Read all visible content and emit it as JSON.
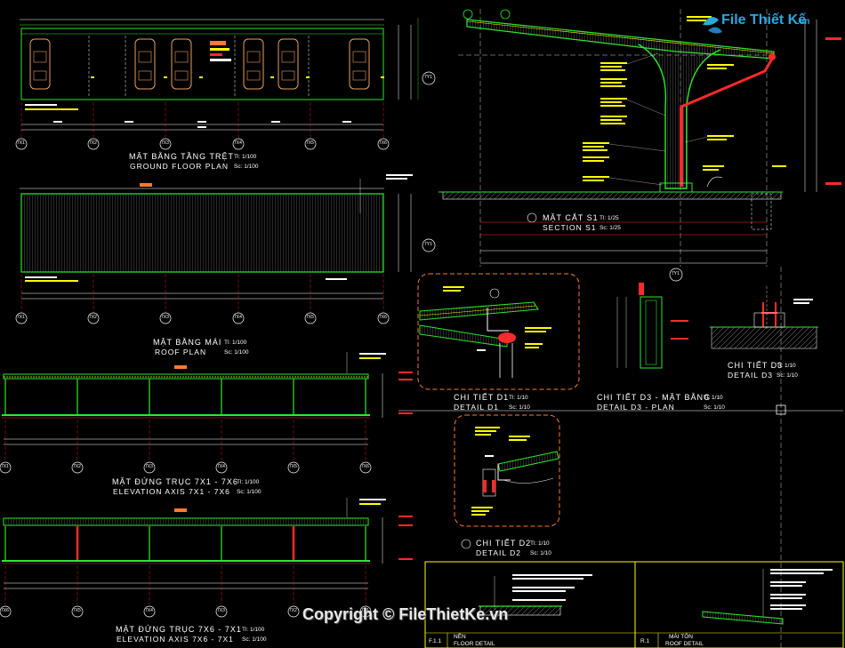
{
  "watermark": {
    "logo_text": "File Thiết Kế",
    "logo_ext": ".vn",
    "copyright": "Copyright © FileThietKe.vn"
  },
  "views": {
    "ground_floor": {
      "title_vn": "MẶT BẰNG TẦNG TRỆT",
      "title_en": "GROUND FLOOR PLAN",
      "scale_vn": "Tl: 1/100",
      "scale_en": "Sc: 1/100"
    },
    "roof_plan": {
      "title_vn": "MẶT BẰNG MÁI",
      "title_en": "ROOF PLAN",
      "scale_vn": "Tl: 1/100",
      "scale_en": "Sc: 1/100"
    },
    "elev_1": {
      "title_vn": "MẶT ĐỨNG TRỤC 7X1 - 7X6",
      "title_en": "ELEVATION AXIS 7X1 - 7X6",
      "scale_vn": "Tl: 1/100",
      "scale_en": "Sc: 1/100"
    },
    "elev_2": {
      "title_vn": "MẶT ĐỨNG TRỤC 7X6 - 7X1",
      "title_en": "ELEVATION AXIS 7X6 - 7X1",
      "scale_vn": "Tl: 1/100",
      "scale_en": "Sc: 1/100"
    },
    "section_s1": {
      "title_vn": "MẶT CẮT S1",
      "title_en": "SECTION S1",
      "scale_vn": "Tl: 1/25",
      "scale_en": "Sc: 1/25"
    },
    "detail_d1": {
      "title_vn": "CHI TIẾT D1",
      "title_en": "DETAIL D1",
      "scale_vn": "Tl: 1/10",
      "scale_en": "Sc: 1/10"
    },
    "detail_d2": {
      "title_vn": "CHI TIẾT D2",
      "title_en": "DETAIL D2",
      "scale_vn": "Tl: 1/10",
      "scale_en": "Sc: 1/10"
    },
    "detail_d3": {
      "title_vn": "CHI TIẾT D3",
      "title_en": "DETAIL D3",
      "scale_vn": "Tl: 1/10",
      "scale_en": "Sc: 1/10"
    },
    "detail_d3_plan": {
      "title_vn": "CHI TIẾT D3 - MẶT BẰNG",
      "title_en": "DETAIL D3 - PLAN",
      "scale_vn": "Tl: 1/10",
      "scale_en": "Sc: 1/10"
    }
  },
  "legend_boxes": {
    "floor": {
      "code": "F.1.1",
      "title_vn": "NỀN",
      "title_en": "FLOOR DETAIL"
    },
    "roof": {
      "code": "R.1",
      "title_vn": "MÁI TÔN",
      "title_en": "ROOF DETAIL"
    }
  },
  "axes": [
    "7X1",
    "7X2",
    "7X3",
    "7X4",
    "7X5",
    "7X6"
  ],
  "cross_axes": [
    "7Y1",
    "7Y2"
  ],
  "colors": {
    "background": "#000000",
    "green": "#2ee82e",
    "red": "#ff2a2a",
    "yellow": "#ffff00",
    "magenta": "#e040e0",
    "orange_dashed": "#ff7a30",
    "white": "#ffffff",
    "logo_blue": "#27a9e1"
  }
}
